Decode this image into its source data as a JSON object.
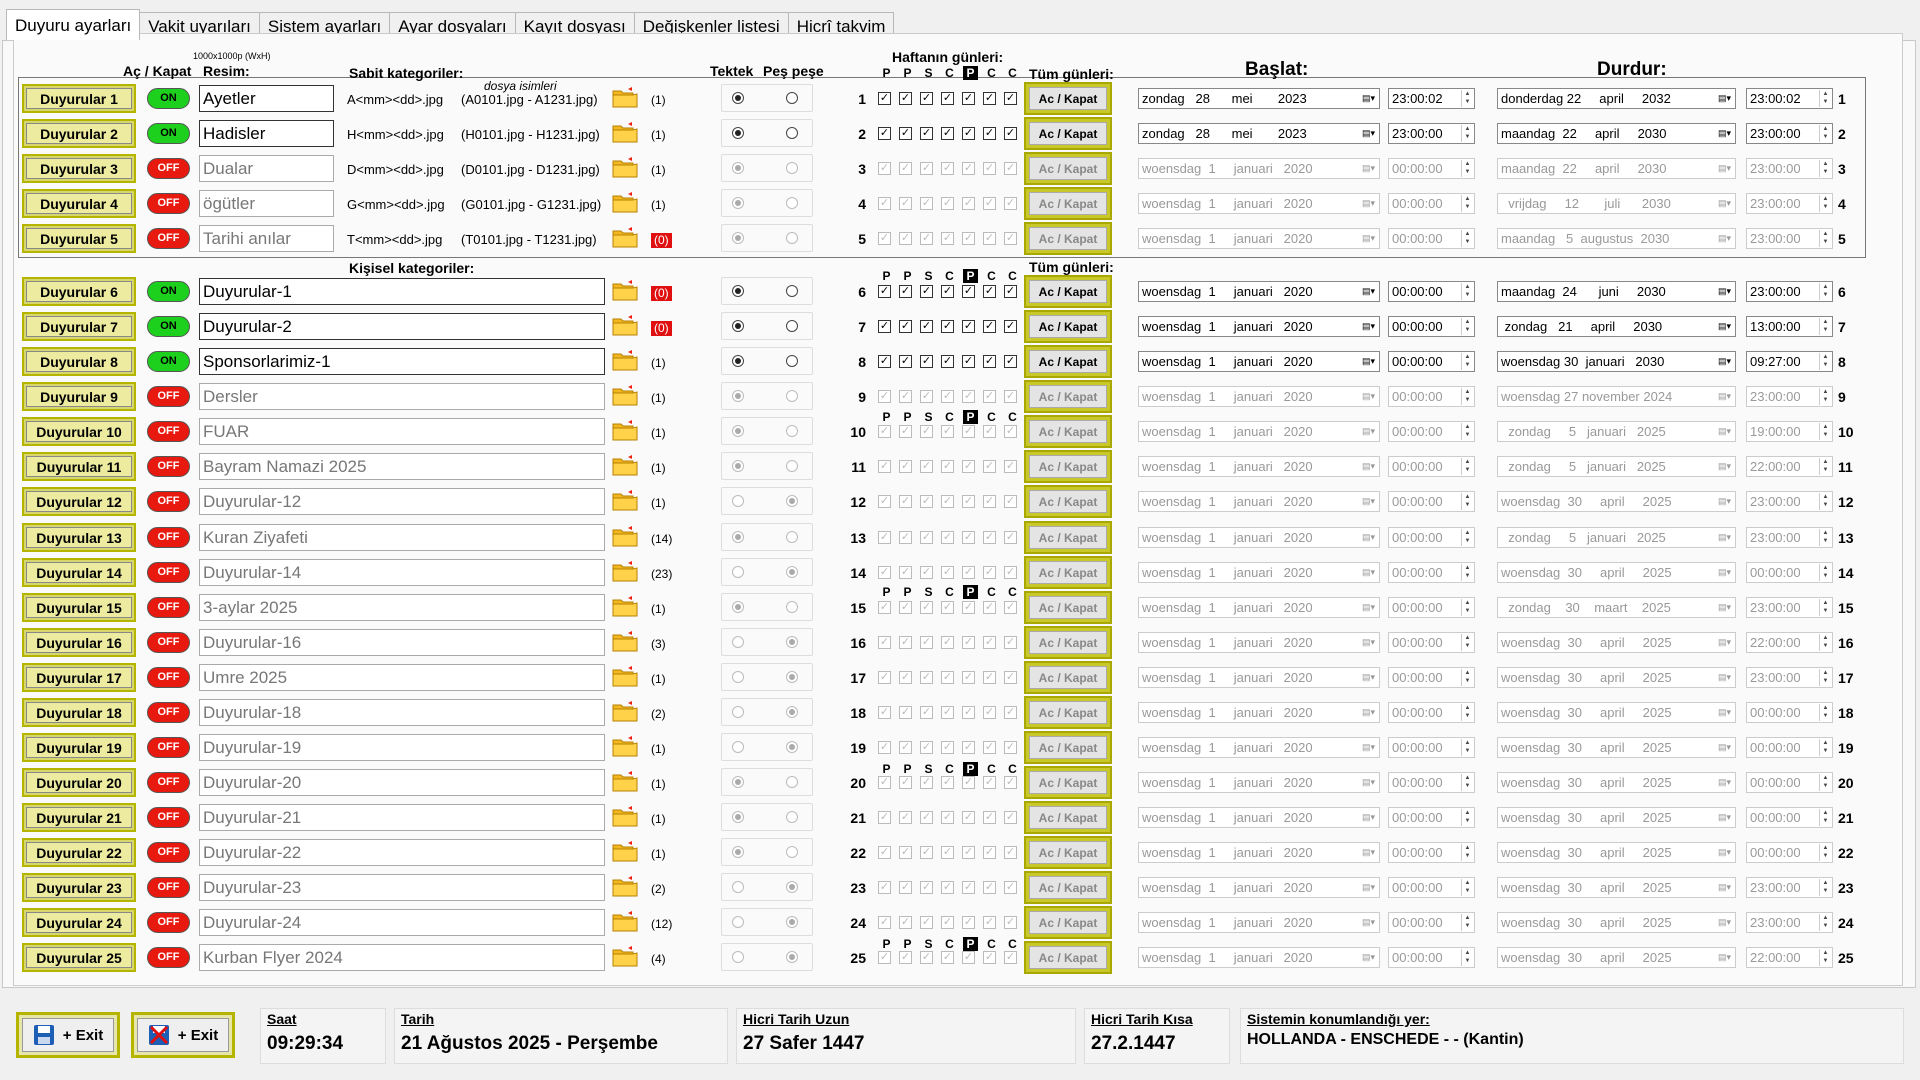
{
  "tabs": [
    "Duyuru ayarları",
    "Vakit uyarıları",
    "Sistem ayarları",
    "Ayar dosyaları",
    "Kayıt dosyası",
    "Değişkenler listesi",
    "Hicrî takvim"
  ],
  "headers": {
    "ac_kapat": "Aç / Kapat",
    "resim": "Resim:",
    "resim_size": "1000x1000p (WxH)",
    "sabit": "Sabit kategoriler:",
    "dosya_isimleri": "dosya isimleri",
    "tektek": "Tektek",
    "pespese": "Peş peşe",
    "haftanin_gunleri": "Haftanın günleri:",
    "tum_gunleri": "Tüm günleri:",
    "baslat": "Başlat:",
    "durdur": "Durdur:",
    "kisisel": "Kişisel kategoriler:",
    "tum_gunleri2": "Tüm günleri:"
  },
  "day_letters": [
    "P",
    "P",
    "S",
    "C",
    "P",
    "C",
    "C"
  ],
  "ac_label": "Ac / Kapat",
  "colors": {
    "on": "#1ed01e",
    "off": "#e8190f",
    "button_frame": "#b5b500",
    "count_red": "#e01010"
  },
  "rows": [
    {
      "n": 1,
      "btn": "Duyurular 1",
      "state": "ON",
      "name": "Ayetler",
      "pattern": "A<mm><dd>.jpg",
      "files": "(A0101.jpg - A1231.jpg)",
      "count": "(1)",
      "red": false,
      "radio": "tek",
      "days": true,
      "start_date": "zondag   28      mei       2023",
      "start_time": "23:00:02",
      "end_date": "donderdag 22     april     2032",
      "end_time": "23:00:02"
    },
    {
      "n": 2,
      "btn": "Duyurular 2",
      "state": "ON",
      "name": "Hadisler",
      "pattern": "H<mm><dd>.jpg",
      "files": "(H0101.jpg - H1231.jpg)",
      "count": "(1)",
      "red": false,
      "radio": "tek",
      "days": true,
      "start_date": "zondag   28      mei       2023",
      "start_time": "23:00:00",
      "end_date": "maandag  22     april     2030",
      "end_time": "23:00:00"
    },
    {
      "n": 3,
      "btn": "Duyurular 3",
      "state": "OFF",
      "name": "Dualar",
      "pattern": "D<mm><dd>.jpg",
      "files": "(D0101.jpg - D1231.jpg)",
      "count": "(1)",
      "red": false,
      "radio": "tek",
      "days": false,
      "start_date": "woensdag  1     januari   2020",
      "start_time": "00:00:00",
      "end_date": "maandag  22     april     2030",
      "end_time": "23:00:00"
    },
    {
      "n": 4,
      "btn": "Duyurular 4",
      "state": "OFF",
      "name": "ögütler",
      "pattern": "G<mm><dd>.jpg",
      "files": "(G0101.jpg - G1231.jpg)",
      "count": "(1)",
      "red": false,
      "radio": "tek",
      "days": false,
      "start_date": "woensdag  1     januari   2020",
      "start_time": "00:00:00",
      "end_date": "  vrijdag     12       juli      2030",
      "end_time": "23:00:00"
    },
    {
      "n": 5,
      "btn": "Duyurular 5",
      "state": "OFF",
      "name": "Tarihi anılar",
      "pattern": "T<mm><dd>.jpg",
      "files": "(T0101.jpg - T1231.jpg)",
      "count": "(0)",
      "red": true,
      "radio": "tek",
      "days": false,
      "start_date": "woensdag  1     januari   2020",
      "start_time": "00:00:00",
      "end_date": "maandag   5  augustus  2030",
      "end_time": "23:00:00"
    },
    {
      "n": 6,
      "btn": "Duyurular 6",
      "state": "ON",
      "name": "Duyurular-1",
      "count": "(0)",
      "red": true,
      "radio": "tek",
      "days": true,
      "start_date": "woensdag  1     januari   2020",
      "start_time": "00:00:00",
      "end_date": "maandag  24      juni     2030",
      "end_time": "23:00:00"
    },
    {
      "n": 7,
      "btn": "Duyurular 7",
      "state": "ON",
      "name": "Duyurular-2",
      "count": "(0)",
      "red": true,
      "radio": "tek",
      "days": true,
      "start_date": "woensdag  1     januari   2020",
      "start_time": "00:00:00",
      "end_date": " zondag   21     april     2030",
      "end_time": "13:00:00"
    },
    {
      "n": 8,
      "btn": "Duyurular 8",
      "state": "ON",
      "name": "Sponsorlarimiz-1",
      "count": "(1)",
      "red": false,
      "radio": "tek",
      "days": true,
      "start_date": "woensdag  1     januari   2020",
      "start_time": "00:00:00",
      "end_date": "woensdag 30  januari   2030",
      "end_time": "09:27:00"
    },
    {
      "n": 9,
      "btn": "Duyurular 9",
      "state": "OFF",
      "name": "Dersler",
      "count": "(1)",
      "red": false,
      "radio": "tek",
      "days": false,
      "start_date": "woensdag  1     januari   2020",
      "start_time": "00:00:00",
      "end_date": "woensdag 27 november 2024",
      "end_time": "23:00:00"
    },
    {
      "n": 10,
      "btn": "Duyurular 10",
      "state": "OFF",
      "name": "FUAR",
      "count": "(1)",
      "red": false,
      "radio": "tek",
      "days": false,
      "start_date": "woensdag  1     januari   2020",
      "start_time": "00:00:00",
      "end_date": "  zondag     5   januari   2025",
      "end_time": "19:00:00"
    },
    {
      "n": 11,
      "btn": "Duyurular 11",
      "state": "OFF",
      "name": "Bayram Namazi 2025",
      "count": "(1)",
      "red": false,
      "radio": "tek",
      "days": false,
      "start_date": "woensdag  1     januari   2020",
      "start_time": "00:00:00",
      "end_date": "  zondag     5   januari   2025",
      "end_time": "22:00:00"
    },
    {
      "n": 12,
      "btn": "Duyurular 12",
      "state": "OFF",
      "name": "Duyurular-12",
      "count": "(1)",
      "red": false,
      "radio": "pes",
      "days": false,
      "start_date": "woensdag  1     januari   2020",
      "start_time": "00:00:00",
      "end_date": "woensdag  30     april     2025",
      "end_time": "23:00:00"
    },
    {
      "n": 13,
      "btn": "Duyurular 13",
      "state": "OFF",
      "name": "Kuran Ziyafeti",
      "count": "(14)",
      "red": false,
      "radio": "tek",
      "days": false,
      "start_date": "woensdag  1     januari   2020",
      "start_time": "00:00:00",
      "end_date": "  zondag     5   januari   2025",
      "end_time": "23:00:00"
    },
    {
      "n": 14,
      "btn": "Duyurular 14",
      "state": "OFF",
      "name": "Duyurular-14",
      "count": "(23)",
      "red": false,
      "radio": "pes",
      "days": false,
      "start_date": "woensdag  1     januari   2020",
      "start_time": "00:00:00",
      "end_date": "woensdag  30     april     2025",
      "end_time": "00:00:00"
    },
    {
      "n": 15,
      "btn": "Duyurular 15",
      "state": "OFF",
      "name": "3-aylar 2025",
      "count": "(1)",
      "red": false,
      "radio": "tek",
      "days": false,
      "start_date": "woensdag  1     januari   2020",
      "start_time": "00:00:00",
      "end_date": "  zondag    30    maart    2025",
      "end_time": "23:00:00"
    },
    {
      "n": 16,
      "btn": "Duyurular 16",
      "state": "OFF",
      "name": "Duyurular-16",
      "count": "(3)",
      "red": false,
      "radio": "pes",
      "days": false,
      "start_date": "woensdag  1     januari   2020",
      "start_time": "00:00:00",
      "end_date": "woensdag  30     april     2025",
      "end_time": "22:00:00"
    },
    {
      "n": 17,
      "btn": "Duyurular 17",
      "state": "OFF",
      "name": "Umre 2025",
      "count": "(1)",
      "red": false,
      "radio": "pes",
      "days": false,
      "start_date": "woensdag  1     januari   2020",
      "start_time": "00:00:00",
      "end_date": "woensdag  30     april     2025",
      "end_time": "23:00:00"
    },
    {
      "n": 18,
      "btn": "Duyurular 18",
      "state": "OFF",
      "name": "Duyurular-18",
      "count": "(2)",
      "red": false,
      "radio": "pes",
      "days": false,
      "start_date": "woensdag  1     januari   2020",
      "start_time": "00:00:00",
      "end_date": "woensdag  30     april     2025",
      "end_time": "00:00:00"
    },
    {
      "n": 19,
      "btn": "Duyurular 19",
      "state": "OFF",
      "name": "Duyurular-19",
      "count": "(1)",
      "red": false,
      "radio": "pes",
      "days": false,
      "start_date": "woensdag  1     januari   2020",
      "start_time": "00:00:00",
      "end_date": "woensdag  30     april     2025",
      "end_time": "00:00:00"
    },
    {
      "n": 20,
      "btn": "Duyurular 20",
      "state": "OFF",
      "name": "Duyurular-20",
      "count": "(1)",
      "red": false,
      "radio": "tek",
      "days": false,
      "start_date": "woensdag  1     januari   2020",
      "start_time": "00:00:00",
      "end_date": "woensdag  30     april     2025",
      "end_time": "00:00:00"
    },
    {
      "n": 21,
      "btn": "Duyurular 21",
      "state": "OFF",
      "name": "Duyurular-21",
      "count": "(1)",
      "red": false,
      "radio": "tek",
      "days": false,
      "start_date": "woensdag  1     januari   2020",
      "start_time": "00:00:00",
      "end_date": "woensdag  30     april     2025",
      "end_time": "00:00:00"
    },
    {
      "n": 22,
      "btn": "Duyurular 22",
      "state": "OFF",
      "name": "Duyurular-22",
      "count": "(1)",
      "red": false,
      "radio": "tek",
      "days": false,
      "start_date": "woensdag  1     januari   2020",
      "start_time": "00:00:00",
      "end_date": "woensdag  30     april     2025",
      "end_time": "00:00:00"
    },
    {
      "n": 23,
      "btn": "Duyurular 23",
      "state": "OFF",
      "name": "Duyurular-23",
      "count": "(2)",
      "red": false,
      "radio": "pes",
      "days": false,
      "start_date": "woensdag  1     januari   2020",
      "start_time": "00:00:00",
      "end_date": "woensdag  30     april     2025",
      "end_time": "23:00:00"
    },
    {
      "n": 24,
      "btn": "Duyurular 24",
      "state": "OFF",
      "name": "Duyurular-24",
      "count": "(12)",
      "red": false,
      "radio": "pes",
      "days": false,
      "start_date": "woensdag  1     januari   2020",
      "start_time": "00:00:00",
      "end_date": "woensdag  30     april     2025",
      "end_time": "23:00:00"
    },
    {
      "n": 25,
      "btn": "Duyurular 25",
      "state": "OFF",
      "name": "Kurban Flyer 2024",
      "count": "(4)",
      "red": false,
      "radio": "pes",
      "days": false,
      "start_date": "woensdag  1     januari   2020",
      "start_time": "00:00:00",
      "end_date": "woensdag  30     april     2025",
      "end_time": "22:00:00"
    }
  ],
  "bottom": {
    "save_label": "+ Exit",
    "nosave_label": "+ Exit",
    "saat_label": "Saat",
    "saat": "09:29:34",
    "tarih_label": "Tarih",
    "tarih": "21 Ağustos 2025 - Perşembe",
    "hicri_uzun_label": "Hicri Tarih Uzun",
    "hicri_uzun": "27 Safer 1447",
    "hicri_kisa_label": "Hicri Tarih Kısa",
    "hicri_kisa": "27.2.1447",
    "konum_label": "Sistemin konumlandığı yer:",
    "konum": "HOLLANDA - ENSCHEDE -  -  (Kantin)"
  }
}
